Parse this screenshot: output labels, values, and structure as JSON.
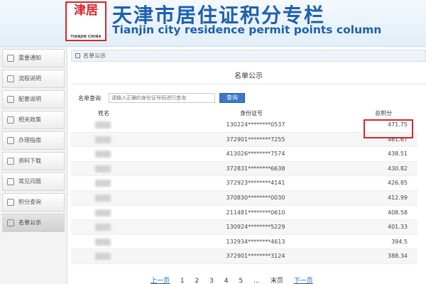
{
  "header": {
    "logo_text": "津居",
    "logo_sub": "TIANJIN CHINA",
    "title_cn": "天津市居住证积分专栏",
    "title_en": "Tianjin city residence permit points column"
  },
  "sidebar": {
    "items": [
      {
        "label": "重要通知"
      },
      {
        "label": "流程说明"
      },
      {
        "label": "配套说明"
      },
      {
        "label": "相关政策"
      },
      {
        "label": "办理指南"
      },
      {
        "label": "资料下载"
      },
      {
        "label": "常见问题"
      },
      {
        "label": "积分查询"
      },
      {
        "label": "名单公示"
      }
    ]
  },
  "main": {
    "breadcrumb": "名单公示",
    "list_title": "名单公示",
    "search": {
      "label": "名单查询",
      "placeholder": "请输入正确的身份证号码进行查询",
      "button": "查询"
    },
    "table": {
      "headers": {
        "name": "姓名",
        "id": "身份证号",
        "points": "总积分"
      },
      "rows": [
        {
          "id": "130224********0537",
          "points": "471.75"
        },
        {
          "id": "372901********7255",
          "points": "461.67"
        },
        {
          "id": "413026********7574",
          "points": "438.51"
        },
        {
          "id": "372831********6638",
          "points": "430.82"
        },
        {
          "id": "372923********4141",
          "points": "426.85"
        },
        {
          "id": "370830********0030",
          "points": "412.99"
        },
        {
          "id": "211481********0610",
          "points": "408.58"
        },
        {
          "id": "130924********5229",
          "points": "401.33"
        },
        {
          "id": "132934********4613",
          "points": "394.5"
        },
        {
          "id": "372901********3124",
          "points": "388.34"
        }
      ]
    },
    "pagination": {
      "prev": "上一页",
      "pages": [
        "1",
        "2",
        "3",
        "4",
        "5"
      ],
      "ellipsis": "…",
      "last": "末页",
      "next": "下一页"
    }
  }
}
